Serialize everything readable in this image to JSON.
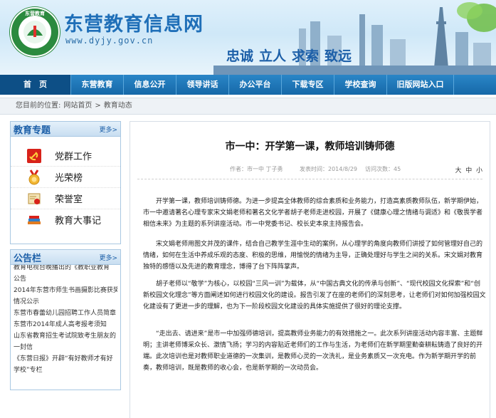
{
  "header": {
    "logo_text": "东营教育",
    "title": "东营教育信息网",
    "url": "www.dyjy.gov.cn",
    "slogan": [
      "忠诚",
      "立人",
      "求索",
      "致远"
    ]
  },
  "nav": {
    "items": [
      "首　页",
      "东营教育",
      "信息公开",
      "领导讲话",
      "办公平台",
      "下载专区",
      "学校查询",
      "旧版网站入口"
    ],
    "active_index": 0
  },
  "breadcrumb": {
    "prefix": "您目前的位置:",
    "home": "网站首页",
    "sep": ">",
    "current": "教育动态"
  },
  "sidebar": {
    "topics_title": "教育专题",
    "more": "更多>",
    "topics": [
      {
        "label": "党群工作",
        "icon": "party-emblem-icon"
      },
      {
        "label": "光荣榜",
        "icon": "medal-icon"
      },
      {
        "label": "荣誉室",
        "icon": "honor-scroll-icon"
      },
      {
        "label": "教育大事记",
        "icon": "books-icon"
      }
    ],
    "notice_title": "公告栏",
    "notice_more": "更多>",
    "notices": [
      "教育电视台晚播出的《教职业教育",
      "公告",
      "2014年东营市师生书画摄影比赛获奖",
      "情况公示",
      "东营市春蕾幼儿园招聘工作人员简章",
      "东营市2014年成人高考报考须知",
      "山东省教育招生考试院致考生朋友的",
      "一封信",
      "《东营日报》开辟“有好教师才有好",
      "学校”专栏"
    ]
  },
  "article": {
    "title": "市一中：开学第一课，教师培训铸师德",
    "author_label": "作者：市一中 丁子勇",
    "time_label": "发表时间：2014/8/29",
    "views_label": "访问次数：45",
    "font_sizes": [
      "大",
      "中",
      "小"
    ],
    "paragraphs": [
      "开学第一课，教师培训铸师德。为进一步提高全体教师的综合素质和业务能力，打造高素质教师队伍，新学期伊始，市一中邀请著名心理专家宋文娟老师和著名文化学者胡子老师走进校园，开展了《健康心理之情绪与调适》和《敬畏学者 相信未来》为主题的系列讲座活动。市一中党委书记、校长史本泉主持报告会。",
      "宋文娟老师用图文并茂的课件，结合自己教学生涯中生动的案例，从心理学的角度向教师们讲授了如何管理好自己的情绪，如何在生活中养成乐观的态度、积极的思维，用愉悦的情绪为主导，正确处理好与学生之间的关系。宋文娟对教育独特的感悟以及先进的教育理念，博得了台下阵阵掌声。",
      "胡子老师以“敬学”为核心，以校园“三风一训”为载体，从“中国古典文化的传承与创新”、“现代校园文化探索”和“创新校园文化理念”等方面阐述如何进行校园文化的建设。报告引发了在座的老师们的深刻思考，让老师们对如何加强校园文化建设有了更进一步的理解，也为下一阶段校园文化建设的具体实施提供了很好的理论支撑。",
      "“走出去、请进来”是市一中加强师德培训，提高教师业务能力的有效措施之一。此次系列讲座活动内容丰富、主题鲜明；主讲老师博采众长、激情飞扬；学习的内容贴近老师们的工作与生活，为老师们在新学期里勤奋耕耘铸造了良好的开端。此次培训也是对教师职业道德的一次集训，是教师心灵的一次洗礼，是业务素质又一次充电。作为新学期开学的前奏，教师培训，既是教师的收心会，也是新学期的一次动员会。"
    ]
  },
  "colors": {
    "nav_blue": "#1668a8",
    "title_blue": "#1f6fb8",
    "logo_green": "#2b8a3e"
  }
}
